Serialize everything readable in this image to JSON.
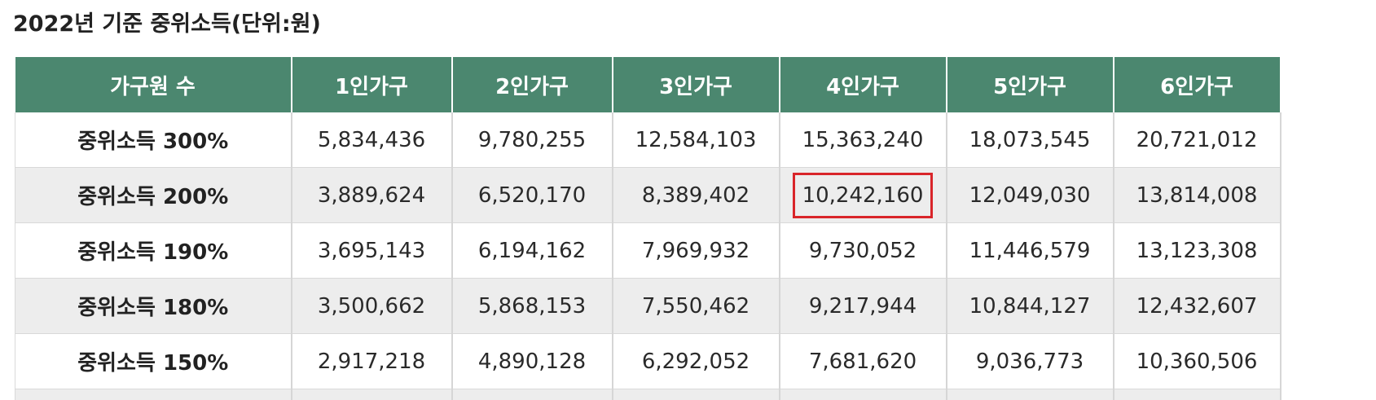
{
  "title": "2022년 기준 중위소득(단위:원)",
  "table": {
    "headers": [
      "가구원 수",
      "1인가구",
      "2인가구",
      "3인가구",
      "4인가구",
      "5인가구",
      "6인가구"
    ],
    "rows": [
      {
        "label": "중위소득 300%",
        "values": [
          "5,834,436",
          "9,780,255",
          "12,584,103",
          "15,363,240",
          "18,073,545",
          "20,721,012"
        ]
      },
      {
        "label": "중위소득 200%",
        "values": [
          "3,889,624",
          "6,520,170",
          "8,389,402",
          "10,242,160",
          "12,049,030",
          "13,814,008"
        ]
      },
      {
        "label": "중위소득 190%",
        "values": [
          "3,695,143",
          "6,194,162",
          "7,969,932",
          "9,730,052",
          "11,446,579",
          "13,123,308"
        ]
      },
      {
        "label": "중위소득 180%",
        "values": [
          "3,500,662",
          "5,868,153",
          "7,550,462",
          "9,217,944",
          "10,844,127",
          "12,432,607"
        ]
      },
      {
        "label": "중위소득 150%",
        "values": [
          "2,917,218",
          "4,890,128",
          "6,292,052",
          "7,681,620",
          "9,036,773",
          "10,360,506"
        ]
      }
    ]
  },
  "colors": {
    "header_bg": "#4b876f",
    "highlight_border": "#d9252a",
    "even_row_bg": "#ededed"
  }
}
